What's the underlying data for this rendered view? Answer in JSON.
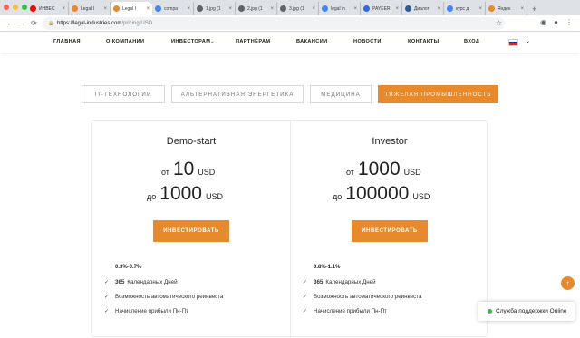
{
  "browser": {
    "tabs": [
      {
        "title": "ИНВЕС",
        "color": "#ff0000"
      },
      {
        "title": "Legal I",
        "color": "#e8892b"
      },
      {
        "title": "Legal I",
        "color": "#e8892b",
        "active": true
      },
      {
        "title": "compa",
        "color": "#4285f4"
      },
      {
        "title": "1.jpg (1",
        "color": "#5f6368"
      },
      {
        "title": "2.jpg (1",
        "color": "#5f6368"
      },
      {
        "title": "3.jpg (1",
        "color": "#5f6368"
      },
      {
        "title": "legal in",
        "color": "#4285f4"
      },
      {
        "title": "PAYEER",
        "color": "#2d6cdf"
      },
      {
        "title": "Диалог",
        "color": "#2d5c99"
      },
      {
        "title": "курс д",
        "color": "#4285f4"
      },
      {
        "title": "Яндек",
        "color": "#e8892b"
      }
    ],
    "new_tab": "+",
    "url_host": "https://legal-industries.com",
    "url_path": "/pricing/USD"
  },
  "header": {
    "nav": [
      "ГЛАВНАЯ",
      "О КОМПАНИИ",
      "ИНВЕСТОРАМ",
      "ПАРТНЁРАМ",
      "ВАКАНСИИ",
      "НОВОСТИ",
      "КОНТАКТЫ",
      "ВХОД"
    ],
    "dropdown_marker": "⌄"
  },
  "categories": [
    {
      "label": "IT-ТЕХНОЛОГИИ"
    },
    {
      "label": "АЛЬТЕРНАТИВНАЯ ЭНЕРГЕТИКА"
    },
    {
      "label": "МЕДИЦИНА"
    },
    {
      "label": "ТЯЖЕЛАЯ ПРОМЫШЛЕННОСТЬ",
      "active": true
    }
  ],
  "plans": [
    {
      "title": "Demo-start",
      "from_prefix": "от",
      "from_amount": "10",
      "from_currency": "USD",
      "to_prefix": "до",
      "to_amount": "1000",
      "to_currency": "USD",
      "button": "ИНВЕСТИРОВАТЬ",
      "rate": "0.3%-0.7%",
      "features": [
        {
          "bold": "365",
          "text": "Календарных Дней"
        },
        {
          "bold": "",
          "text": "Возможность автоматического реинвеста"
        },
        {
          "bold": "",
          "text": "Начисление прибыли Пн-Пт"
        }
      ]
    },
    {
      "title": "Investor",
      "from_prefix": "от",
      "from_amount": "1000",
      "from_currency": "USD",
      "to_prefix": "до",
      "to_amount": "100000",
      "to_currency": "USD",
      "button": "ИНВЕСТИРОВАТЬ",
      "rate": "0.8%-1.1%",
      "features": [
        {
          "bold": "365",
          "text": "Календарных Дней"
        },
        {
          "bold": "",
          "text": "Возможность автоматического реинвеста"
        },
        {
          "bold": "",
          "text": "Начисление прибыли Пн-Пт"
        }
      ]
    }
  ],
  "support": {
    "label": "Служба поддержки Online"
  },
  "colors": {
    "accent": "#e8892b",
    "online": "#3bb34a"
  }
}
